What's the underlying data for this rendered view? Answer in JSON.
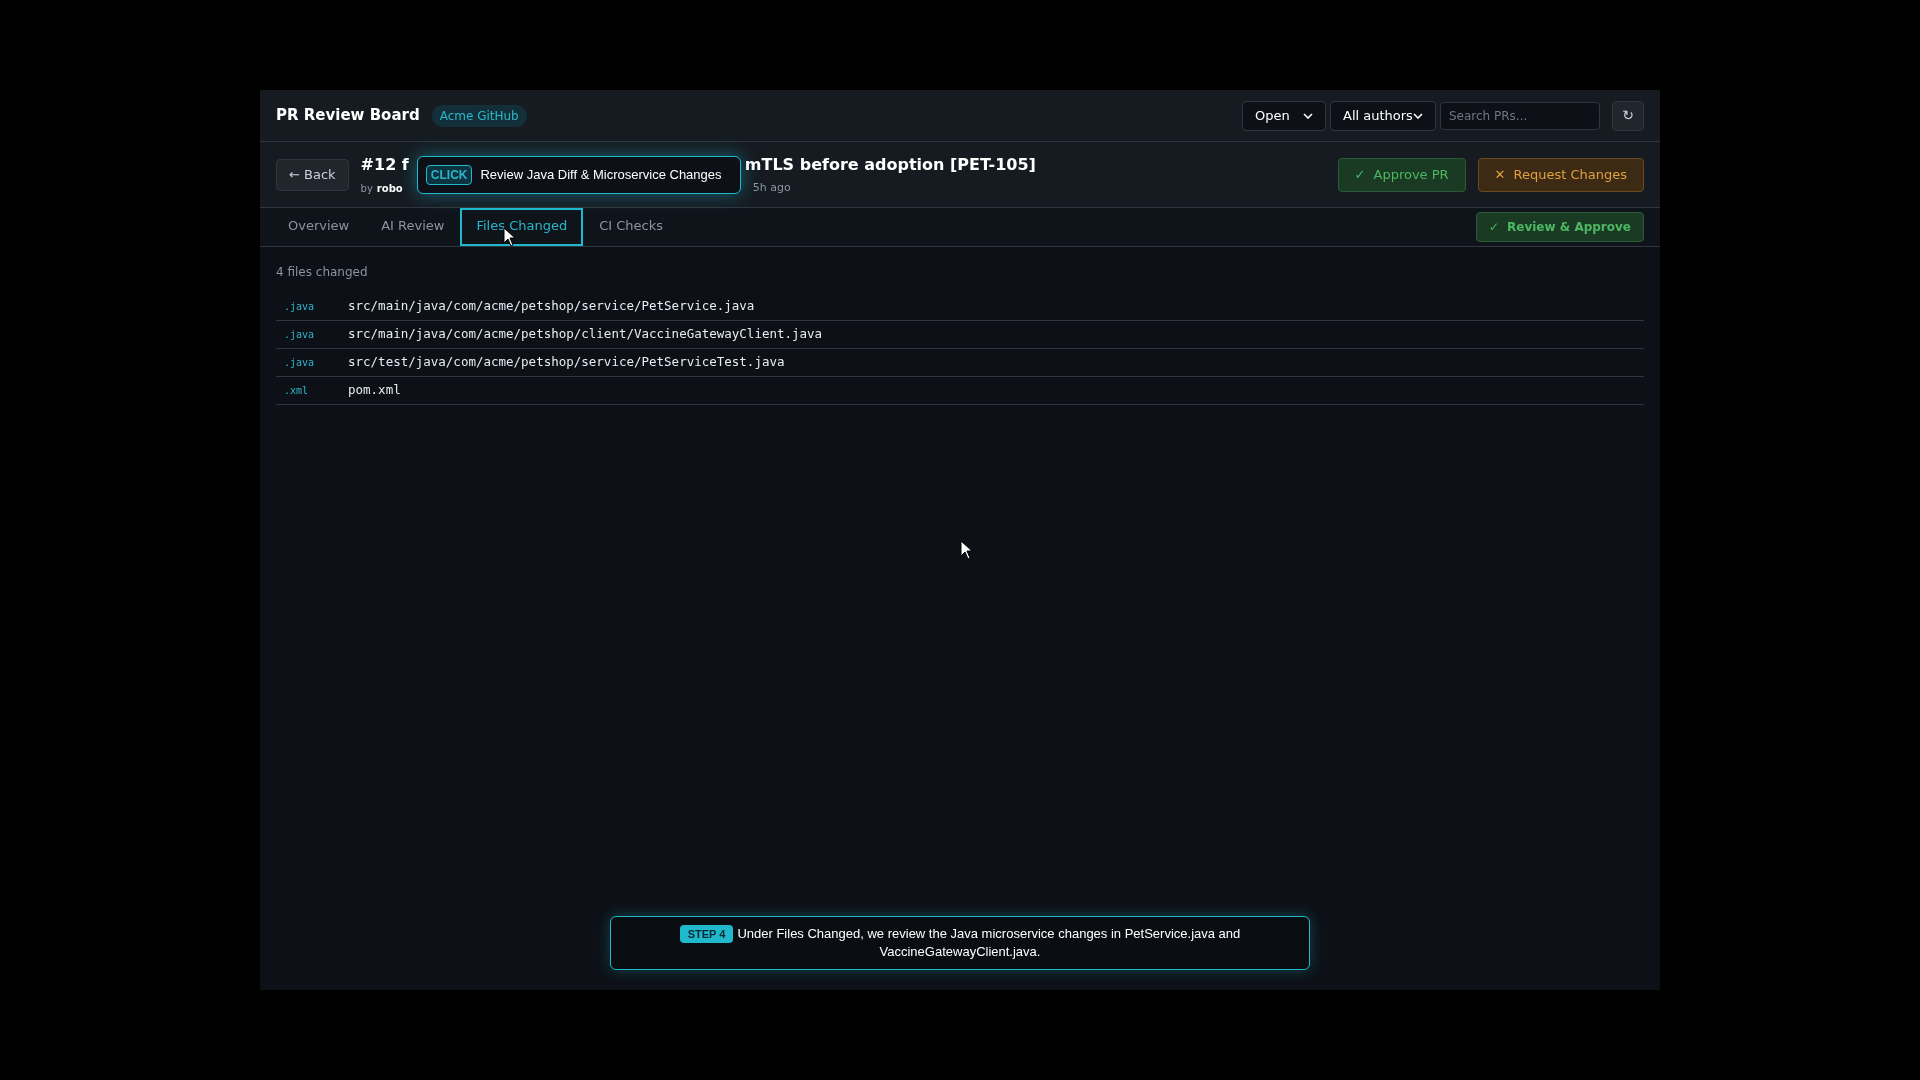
{
  "app": {
    "title": "PR Review Board",
    "org_badge": "Acme GitHub"
  },
  "filters": {
    "status": "Open",
    "author": "All authors",
    "search": {
      "placeholder": "Search PRs..."
    },
    "refresh": "↻"
  },
  "pr": {
    "back": "← Back",
    "title_start": "#12 f",
    "title_end": "mTLS before adoption [PET-105]",
    "by": "by",
    "author": "robo",
    "age": "5h ago"
  },
  "actions": [
    {
      "label": "Approve PR",
      "icon": "✓",
      "kind": "approve"
    },
    {
      "label": "Request Changes",
      "icon": "✕",
      "kind": "request"
    }
  ],
  "tabs": [
    {
      "label": "Overview",
      "selected": false
    },
    {
      "label": "AI Review",
      "selected": false
    },
    {
      "label": "Files Changed",
      "selected": true
    },
    {
      "label": "CI Checks",
      "selected": false
    }
  ],
  "review_button": {
    "icon": "✓",
    "label": "Review & Approve"
  },
  "files_summary": "4 files changed",
  "files": [
    {
      "ext": ".java",
      "path": "src/main/java/com/acme/petshop/service/PetService.java"
    },
    {
      "ext": ".java",
      "path": "src/main/java/com/acme/petshop/client/VaccineGatewayClient.java"
    },
    {
      "ext": ".java",
      "path": "src/test/java/com/acme/petshop/service/PetServiceTest.java"
    },
    {
      "ext": ".xml",
      "path": "pom.xml"
    }
  ],
  "tooltip": {
    "action": "CLICK",
    "text": "Review Java Diff & Microservice Changes"
  },
  "step_banner": {
    "step": "STEP 4",
    "text": "Under Files Changed, we review the Java microservice changes in PetService.java and VaccineGatewayClient.java."
  }
}
